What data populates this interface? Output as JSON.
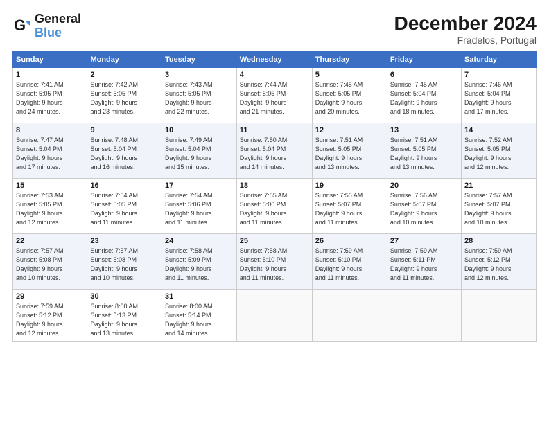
{
  "header": {
    "logo_line1": "General",
    "logo_line2": "Blue",
    "month": "December 2024",
    "location": "Fradelos, Portugal"
  },
  "weekdays": [
    "Sunday",
    "Monday",
    "Tuesday",
    "Wednesday",
    "Thursday",
    "Friday",
    "Saturday"
  ],
  "weeks": [
    [
      {
        "day": "1",
        "info": "Sunrise: 7:41 AM\nSunset: 5:05 PM\nDaylight: 9 hours\nand 24 minutes."
      },
      {
        "day": "2",
        "info": "Sunrise: 7:42 AM\nSunset: 5:05 PM\nDaylight: 9 hours\nand 23 minutes."
      },
      {
        "day": "3",
        "info": "Sunrise: 7:43 AM\nSunset: 5:05 PM\nDaylight: 9 hours\nand 22 minutes."
      },
      {
        "day": "4",
        "info": "Sunrise: 7:44 AM\nSunset: 5:05 PM\nDaylight: 9 hours\nand 21 minutes."
      },
      {
        "day": "5",
        "info": "Sunrise: 7:45 AM\nSunset: 5:05 PM\nDaylight: 9 hours\nand 20 minutes."
      },
      {
        "day": "6",
        "info": "Sunrise: 7:45 AM\nSunset: 5:04 PM\nDaylight: 9 hours\nand 18 minutes."
      },
      {
        "day": "7",
        "info": "Sunrise: 7:46 AM\nSunset: 5:04 PM\nDaylight: 9 hours\nand 17 minutes."
      }
    ],
    [
      {
        "day": "8",
        "info": "Sunrise: 7:47 AM\nSunset: 5:04 PM\nDaylight: 9 hours\nand 17 minutes."
      },
      {
        "day": "9",
        "info": "Sunrise: 7:48 AM\nSunset: 5:04 PM\nDaylight: 9 hours\nand 16 minutes."
      },
      {
        "day": "10",
        "info": "Sunrise: 7:49 AM\nSunset: 5:04 PM\nDaylight: 9 hours\nand 15 minutes."
      },
      {
        "day": "11",
        "info": "Sunrise: 7:50 AM\nSunset: 5:04 PM\nDaylight: 9 hours\nand 14 minutes."
      },
      {
        "day": "12",
        "info": "Sunrise: 7:51 AM\nSunset: 5:05 PM\nDaylight: 9 hours\nand 13 minutes."
      },
      {
        "day": "13",
        "info": "Sunrise: 7:51 AM\nSunset: 5:05 PM\nDaylight: 9 hours\nand 13 minutes."
      },
      {
        "day": "14",
        "info": "Sunrise: 7:52 AM\nSunset: 5:05 PM\nDaylight: 9 hours\nand 12 minutes."
      }
    ],
    [
      {
        "day": "15",
        "info": "Sunrise: 7:53 AM\nSunset: 5:05 PM\nDaylight: 9 hours\nand 12 minutes."
      },
      {
        "day": "16",
        "info": "Sunrise: 7:54 AM\nSunset: 5:05 PM\nDaylight: 9 hours\nand 11 minutes."
      },
      {
        "day": "17",
        "info": "Sunrise: 7:54 AM\nSunset: 5:06 PM\nDaylight: 9 hours\nand 11 minutes."
      },
      {
        "day": "18",
        "info": "Sunrise: 7:55 AM\nSunset: 5:06 PM\nDaylight: 9 hours\nand 11 minutes."
      },
      {
        "day": "19",
        "info": "Sunrise: 7:55 AM\nSunset: 5:07 PM\nDaylight: 9 hours\nand 11 minutes."
      },
      {
        "day": "20",
        "info": "Sunrise: 7:56 AM\nSunset: 5:07 PM\nDaylight: 9 hours\nand 10 minutes."
      },
      {
        "day": "21",
        "info": "Sunrise: 7:57 AM\nSunset: 5:07 PM\nDaylight: 9 hours\nand 10 minutes."
      }
    ],
    [
      {
        "day": "22",
        "info": "Sunrise: 7:57 AM\nSunset: 5:08 PM\nDaylight: 9 hours\nand 10 minutes."
      },
      {
        "day": "23",
        "info": "Sunrise: 7:57 AM\nSunset: 5:08 PM\nDaylight: 9 hours\nand 10 minutes."
      },
      {
        "day": "24",
        "info": "Sunrise: 7:58 AM\nSunset: 5:09 PM\nDaylight: 9 hours\nand 11 minutes."
      },
      {
        "day": "25",
        "info": "Sunrise: 7:58 AM\nSunset: 5:10 PM\nDaylight: 9 hours\nand 11 minutes."
      },
      {
        "day": "26",
        "info": "Sunrise: 7:59 AM\nSunset: 5:10 PM\nDaylight: 9 hours\nand 11 minutes."
      },
      {
        "day": "27",
        "info": "Sunrise: 7:59 AM\nSunset: 5:11 PM\nDaylight: 9 hours\nand 11 minutes."
      },
      {
        "day": "28",
        "info": "Sunrise: 7:59 AM\nSunset: 5:12 PM\nDaylight: 9 hours\nand 12 minutes."
      }
    ],
    [
      {
        "day": "29",
        "info": "Sunrise: 7:59 AM\nSunset: 5:12 PM\nDaylight: 9 hours\nand 12 minutes."
      },
      {
        "day": "30",
        "info": "Sunrise: 8:00 AM\nSunset: 5:13 PM\nDaylight: 9 hours\nand 13 minutes."
      },
      {
        "day": "31",
        "info": "Sunrise: 8:00 AM\nSunset: 5:14 PM\nDaylight: 9 hours\nand 14 minutes."
      },
      null,
      null,
      null,
      null
    ]
  ]
}
